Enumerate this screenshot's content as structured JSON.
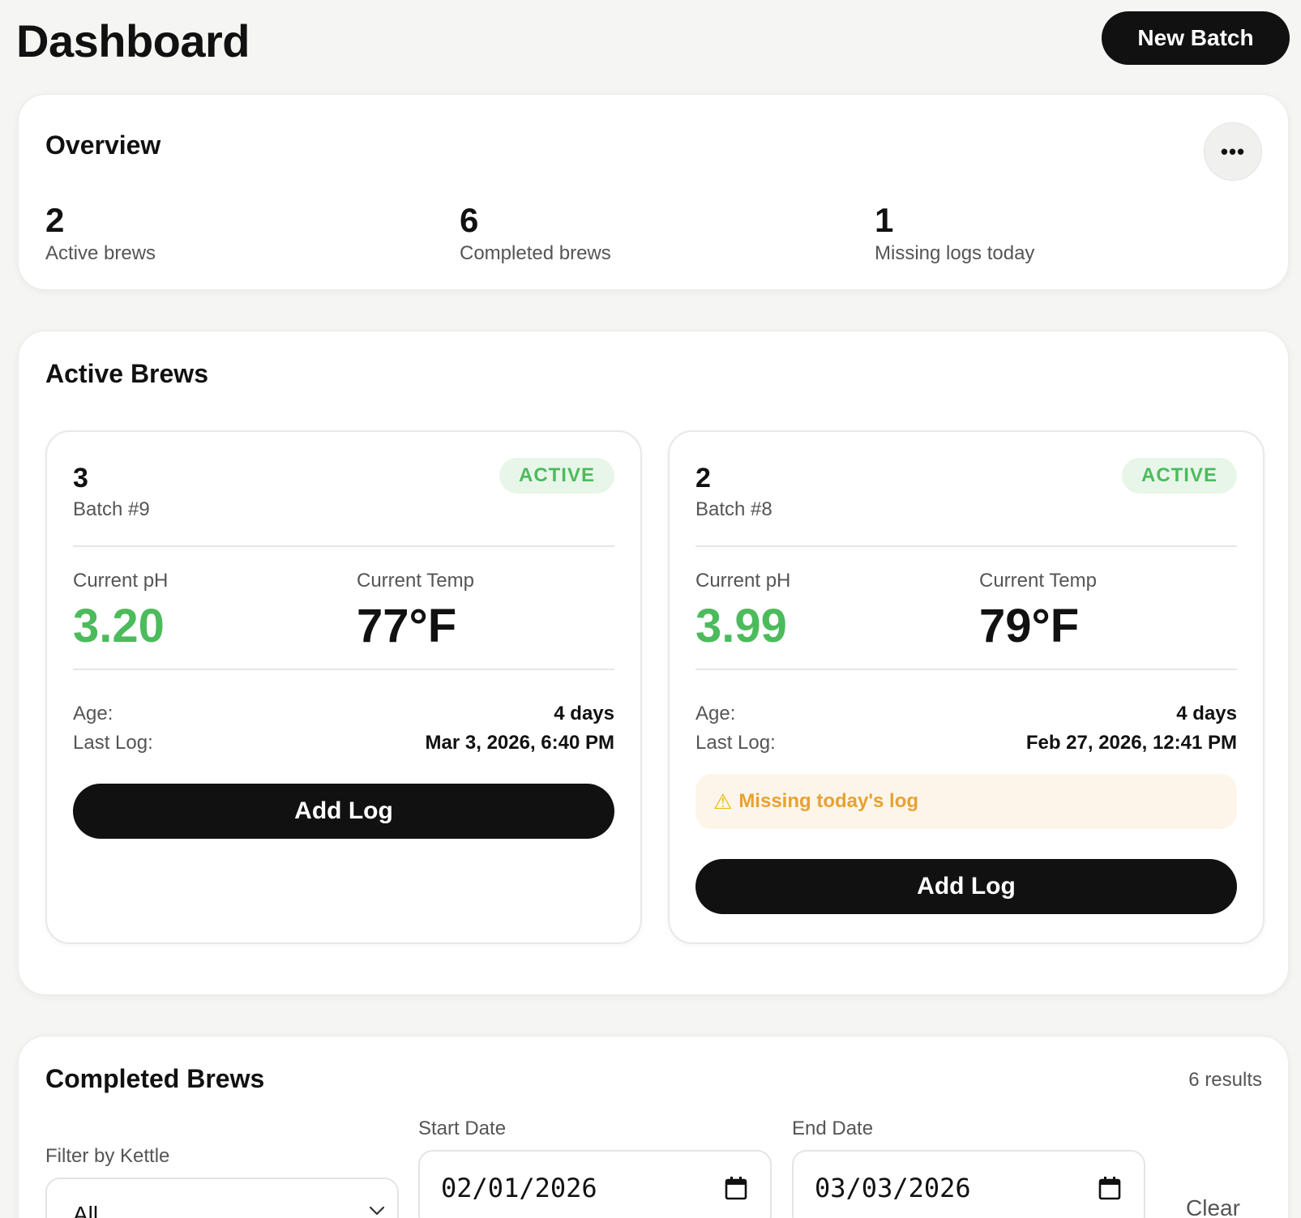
{
  "header": {
    "title": "Dashboard",
    "new_batch_label": "New Batch"
  },
  "overview": {
    "title": "Overview",
    "more_icon": "more-horizontal-icon",
    "stats": [
      {
        "value": "2",
        "label": "Active brews"
      },
      {
        "value": "6",
        "label": "Completed brews"
      },
      {
        "value": "1",
        "label": "Missing logs today"
      }
    ]
  },
  "active_brews": {
    "title": "Active Brews",
    "items": [
      {
        "kettle": "3",
        "batch": "Batch #9",
        "status": "ACTIVE",
        "ph_label": "Current pH",
        "ph_value": "3.20",
        "temp_label": "Current Temp",
        "temp_value": "77°F",
        "age_label": "Age:",
        "age_value": "4 days",
        "last_log_label": "Last Log:",
        "last_log_value": "Mar 3, 2026, 6:40 PM",
        "add_log_label": "Add Log"
      },
      {
        "kettle": "2",
        "batch": "Batch #8",
        "status": "ACTIVE",
        "ph_label": "Current pH",
        "ph_value": "3.99",
        "temp_label": "Current Temp",
        "temp_value": "79°F",
        "age_label": "Age:",
        "age_value": "4 days",
        "last_log_label": "Last Log:",
        "last_log_value": "Feb 27, 2026, 12:41 PM",
        "warning": "Missing today's log",
        "add_log_label": "Add Log"
      }
    ]
  },
  "completed_brews": {
    "title": "Completed Brews",
    "results": "6 results",
    "filter_label": "Filter by Kettle",
    "filter_value": "All",
    "start_label": "Start Date",
    "start_value": "02/01/2026",
    "end_label": "End Date",
    "end_value": "03/03/2026",
    "clear_label": "Clear"
  },
  "colors": {
    "accent": "#111111",
    "success": "#4cbb5c",
    "warning": "#e6a231",
    "background": "#f5f5f3"
  }
}
